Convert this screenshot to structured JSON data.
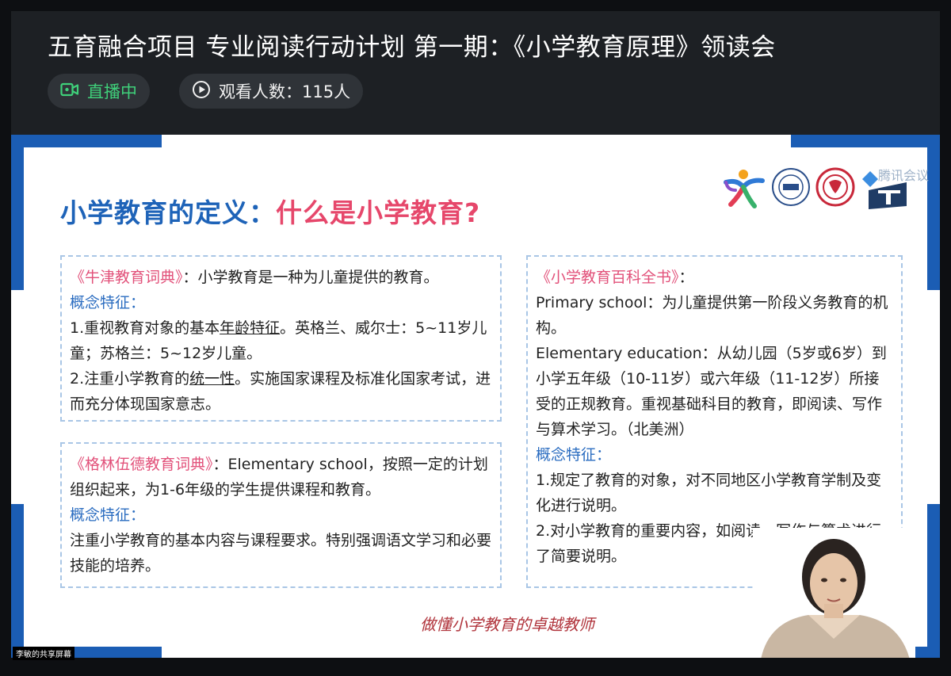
{
  "header": {
    "title": "五育融合项目 专业阅读行动计划 第一期：《小学教育原理》领读会",
    "live_label": "直播中",
    "viewers_label": "观看人数：115人"
  },
  "slide": {
    "heading_part1": "小学教育的定义：",
    "heading_part2": "什么是小学教育?",
    "logo_text": "腾讯会议",
    "box1": {
      "source": "《牛津教育词典》",
      "definition": "：小学教育是一种为儿童提供的教育。",
      "feature_label": "概念特征：",
      "p1_pre": "1.重视教育对象的基本",
      "p1_ul": "年龄特征",
      "p1_post": "。英格兰、威尔士：5~11岁儿童；苏格兰：5~12岁儿童。",
      "p2_pre": "2.注重小学教育的",
      "p2_ul": "统一性",
      "p2_post": "。实施国家课程及标准化国家考试，进而充分体现国家意志。"
    },
    "box2": {
      "source": "《格林伍德教育词典》",
      "definition": "：Elementary school，按照一定的计划组织起来，为1-6年级的学生提供课程和教育。",
      "feature_label": "概念特征：",
      "p1": "注重小学教育的基本内容与课程要求。特别强调语文学习和必要技能的培养。"
    },
    "box3": {
      "source": "《小学教育百科全书》",
      "colon": "：",
      "p1": "Primary school：为儿童提供第一阶段义务教育的机构。",
      "p2": "Elementary education：从幼儿园（5岁或6岁）到小学五年级（10-11岁）或六年级（11-12岁）所接受的正规教育。重视基础科目的教育，即阅读、写作与算术学习。（北美洲）",
      "feature_label": "概念特征：",
      "f1": "1.规定了教育的对象，对不同地区小学教育学制及变化进行说明。",
      "f2": "2.对小学教育的重要内容，如阅读、写作与算术进行了简要说明。"
    },
    "footer_slogan": "做懂小学教育的卓越教师"
  },
  "share_label": "李敏的共享屏幕",
  "colors": {
    "live_green": "#3fd07a",
    "accent_blue": "#1e63b8",
    "accent_red": "#e6476b",
    "frame_blue": "#1b5db4"
  }
}
